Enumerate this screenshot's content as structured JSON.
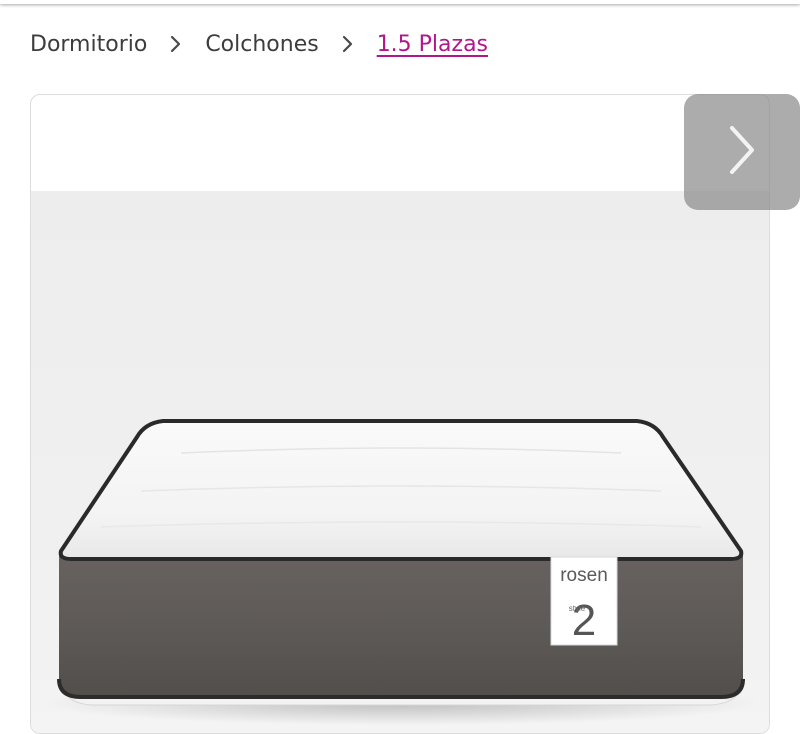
{
  "breadcrumb": {
    "items": [
      {
        "label": "Dormitorio"
      },
      {
        "label": "Colchones"
      },
      {
        "label": "1.5 Plazas"
      }
    ]
  },
  "product_image": {
    "label_brand": "rosen",
    "label_model": "2",
    "label_line": "style"
  },
  "colors": {
    "accent": "#b0178a",
    "text": "#3d3d3d",
    "mattress_side": "#5e5a57",
    "nav_button": "#8c8c8c"
  },
  "icons": {
    "separator": "chevron-right-icon",
    "next": "chevron-right-icon"
  }
}
